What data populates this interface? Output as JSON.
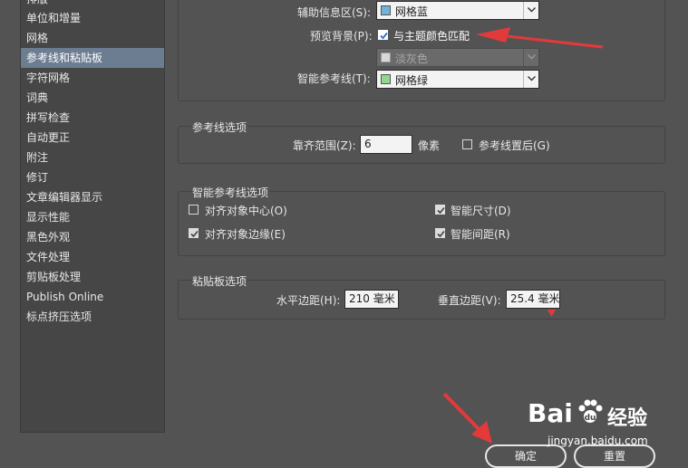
{
  "sidebar": {
    "items": [
      {
        "label": "排版"
      },
      {
        "label": "单位和增量"
      },
      {
        "label": "网格"
      },
      {
        "label": "参考线和粘贴板"
      },
      {
        "label": "字符网格"
      },
      {
        "label": "词典"
      },
      {
        "label": "拼写检查"
      },
      {
        "label": "自动更正"
      },
      {
        "label": "附注"
      },
      {
        "label": "修订"
      },
      {
        "label": "文章编辑器显示"
      },
      {
        "label": "显示性能"
      },
      {
        "label": "黑色外观"
      },
      {
        "label": "文件处理"
      },
      {
        "label": "剪贴板处理"
      },
      {
        "label": "Publish Online"
      },
      {
        "label": "标点挤压选项"
      }
    ],
    "active_index": 3
  },
  "color_options": {
    "aux_label": "辅助信息区(S):",
    "aux_value": "网格蓝",
    "aux_color": "#6fb5d9",
    "preview_label": "预览背景(P):",
    "preview_checkbox_label": "与主题颜色匹配",
    "preview_checked": true,
    "preview_disabled_value": "淡灰色",
    "smart_label": "智能参考线(T):",
    "smart_value": "网格绿",
    "smart_color": "#8fd98f"
  },
  "guide_options": {
    "title": "参考线选项",
    "snap_label": "靠齐范围(Z):",
    "snap_value": "6",
    "snap_unit": "像素",
    "guides_back_label": "参考线置后(G)",
    "guides_back_checked": false
  },
  "smart_guide_options": {
    "title": "智能参考线选项",
    "align_center_label": "对齐对象中心(O)",
    "align_center_checked": false,
    "align_edges_label": "对齐对象边缘(E)",
    "align_edges_checked": true,
    "smart_size_label": "智能尺寸(D)",
    "smart_size_checked": true,
    "smart_spacing_label": "智能间距(R)",
    "smart_spacing_checked": true
  },
  "pasteboard_options": {
    "title": "粘贴板选项",
    "h_margin_label": "水平边距(H):",
    "h_margin_value": "210 毫米",
    "v_margin_label": "垂直边距(V):",
    "v_margin_value": "25.4 毫米"
  },
  "buttons": {
    "ok": "确定",
    "reset": "重置"
  },
  "watermark": {
    "brand": "Bai",
    "brand2": "经验",
    "url": "jingyan.baidu.com"
  },
  "colors": {
    "background": "#535353",
    "sidebar_bg": "#464646",
    "sidebar_active": "#6c7d92",
    "annotation_red": "#e23a3a"
  }
}
